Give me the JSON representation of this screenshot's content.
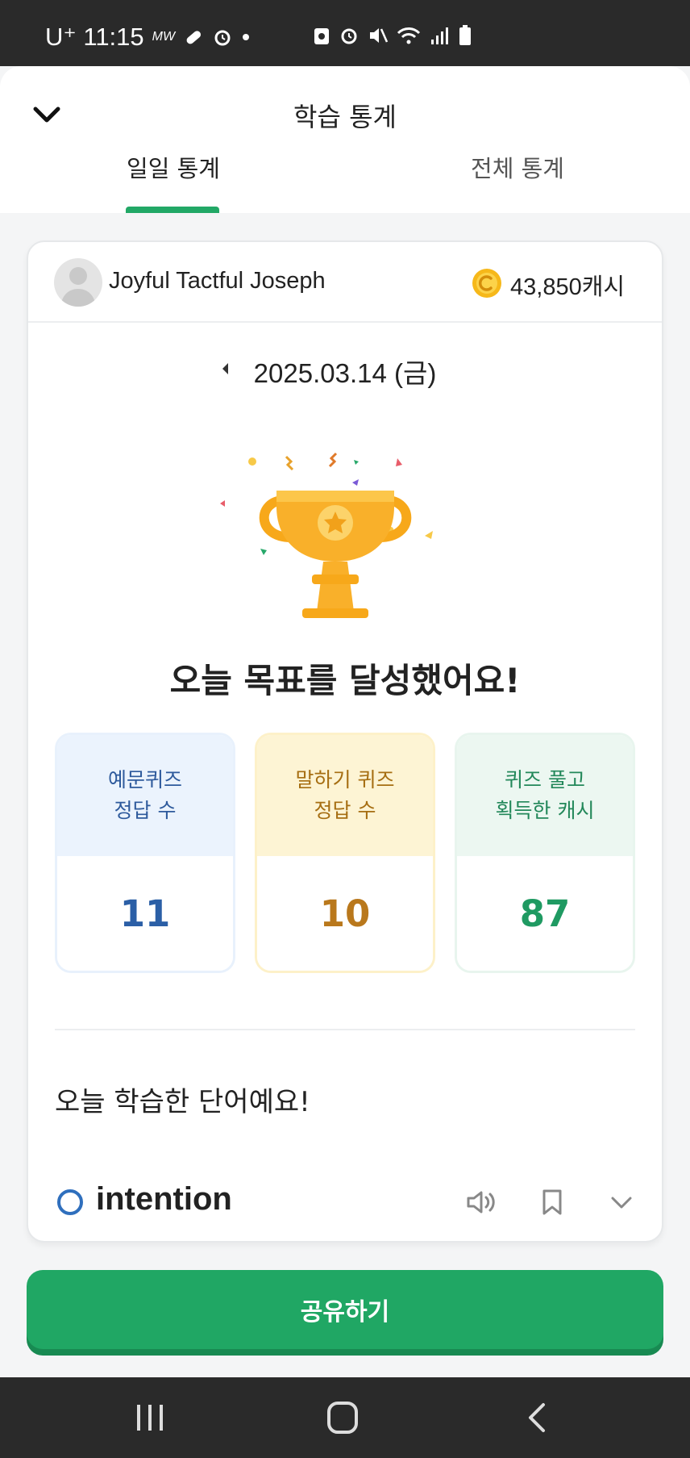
{
  "status_bar": {
    "carrier": "U⁺",
    "time": "11:15",
    "left_icons": [
      "mw-icon",
      "pill-icon",
      "alarm-icon",
      "dot-icon"
    ],
    "right_icons": [
      "recycle-icon",
      "alarm-icon",
      "mute-icon",
      "wifi-icon",
      "signal-icon",
      "battery-icon"
    ]
  },
  "header": {
    "title": "학습 통계",
    "tabs": [
      {
        "label": "일일 통계",
        "active": true
      },
      {
        "label": "전체 통계",
        "active": false
      }
    ]
  },
  "user": {
    "name": "Joyful Tactful Joseph",
    "cash": "43,850캐시"
  },
  "date": "2025.03.14 (금)",
  "goal_message": "오늘 목표를 달성했어요!",
  "stats": [
    {
      "label_line1": "예문퀴즈",
      "label_line2": "정답 수",
      "value": "11"
    },
    {
      "label_line1": "말하기 퀴즈",
      "label_line2": "정답 수",
      "value": "10"
    },
    {
      "label_line1": "퀴즈 풀고",
      "label_line2": "획득한 캐시",
      "value": "87"
    }
  ],
  "words_section": {
    "title": "오늘 학습한 단어예요!",
    "words": [
      {
        "word": "intention",
        "status": "correct"
      }
    ]
  },
  "share_button": "공유하기",
  "colors": {
    "accent": "#20a764",
    "blue": "#2b5fa6",
    "orange": "#b9781c",
    "green": "#1f9a62"
  }
}
